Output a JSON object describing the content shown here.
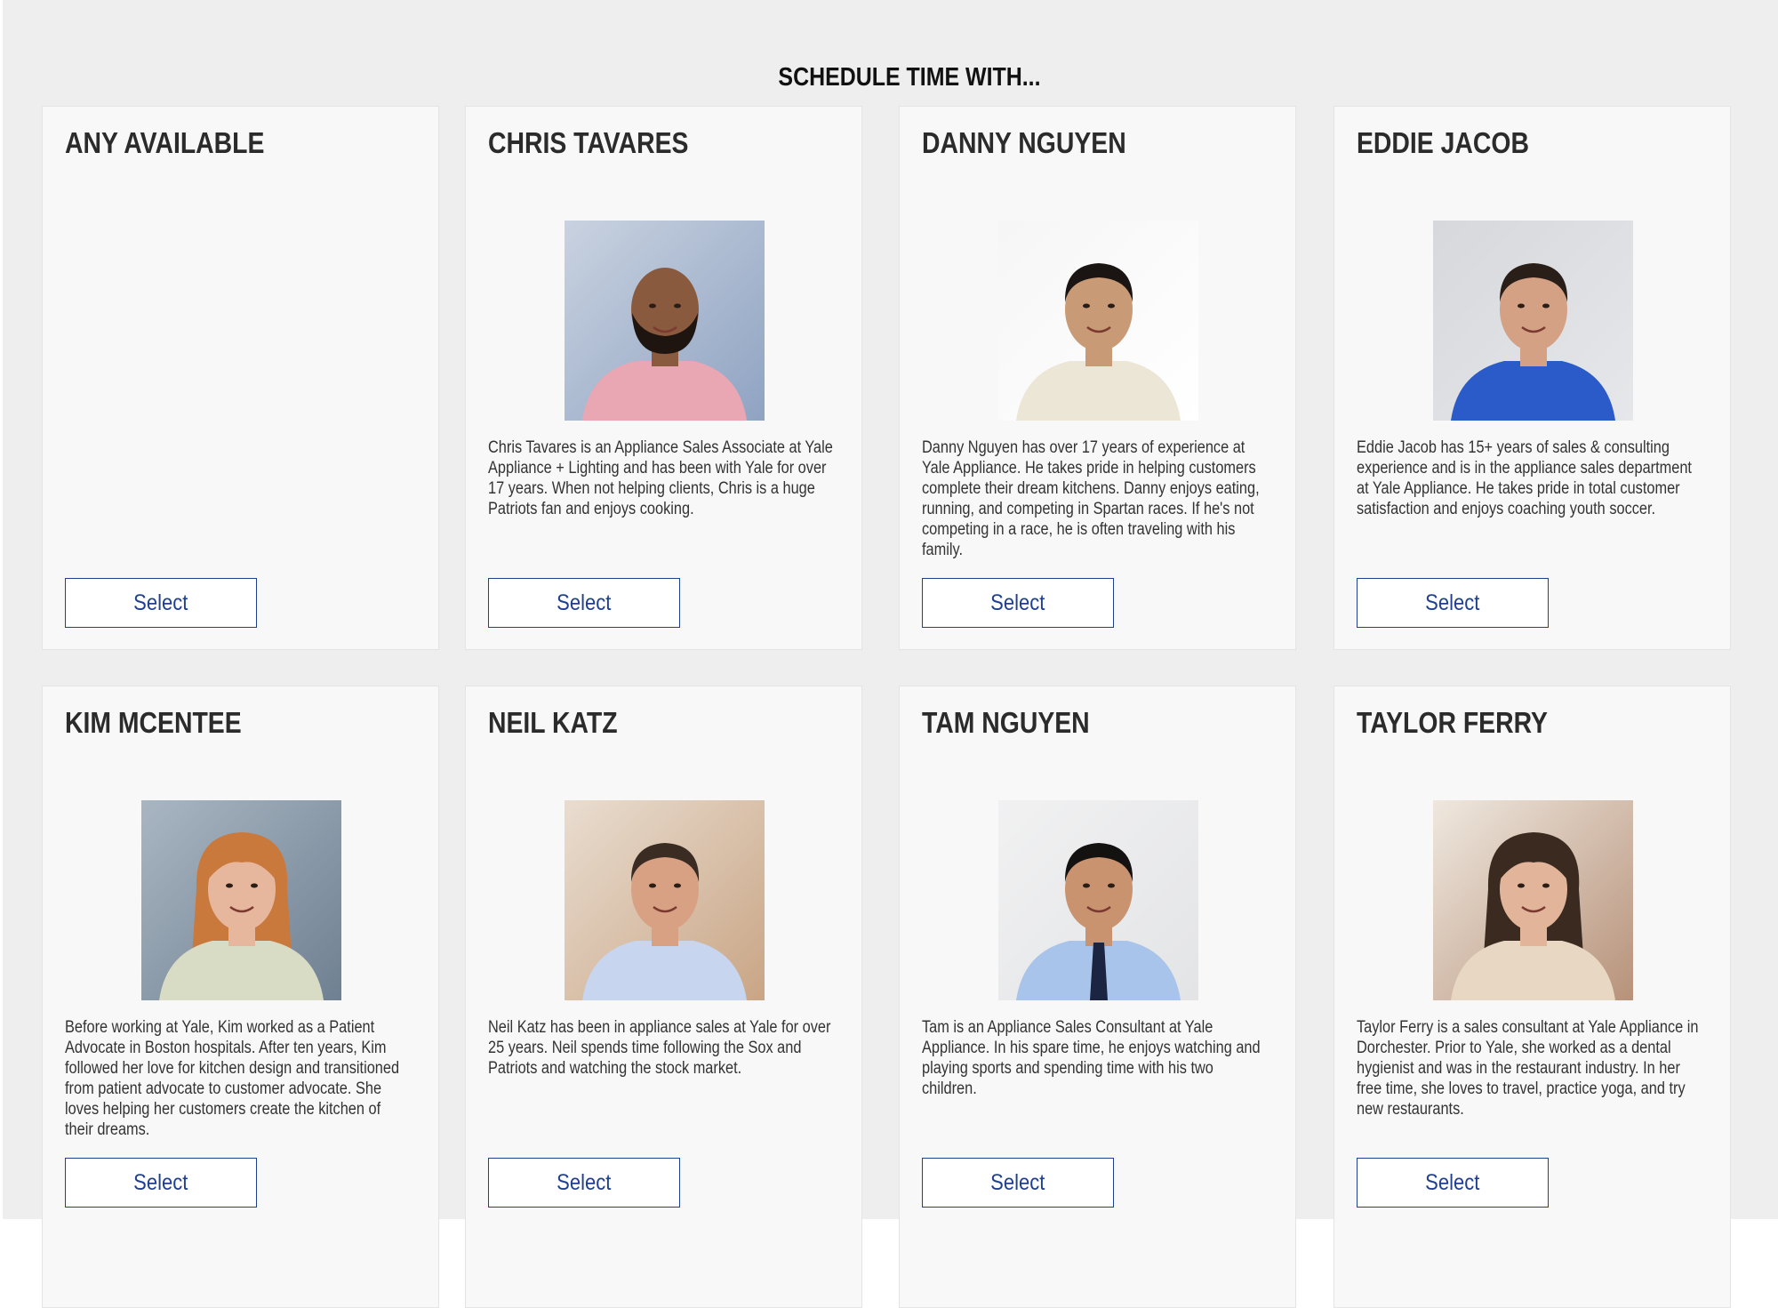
{
  "header": {
    "title": "SCHEDULE TIME WITH..."
  },
  "cards": [
    {
      "name": "ANY AVAILABLE",
      "bio": "",
      "button": "Select",
      "photo": null
    },
    {
      "name": "CHRIS TAVARES",
      "bio": "Chris Tavares is an Appliance Sales Associate at Yale Appliance + Lighting and has been with Yale for over 17 years. When not helping clients, Chris is a huge Patriots fan and enjoys cooking.",
      "button": "Select",
      "photo": {
        "bg": "#8fa3c2",
        "bg2": "#c9d2e0",
        "skin": "#8a5a3e",
        "hair": "#1e1410",
        "shirt": "#e8a7b3",
        "beard": true,
        "bald": true
      }
    },
    {
      "name": "DANNY NGUYEN",
      "bio": "Danny Nguyen has over 17 years of experience at Yale Appliance. He takes pride in helping customers complete their dream kitchens. Danny enjoys eating, running, and competing in Spartan races. If he's not competing in a race, he is often traveling with his family.",
      "button": "Select",
      "photo": {
        "bg": "#ffffff",
        "bg2": "#f6f6f6",
        "skin": "#c89a75",
        "hair": "#1a1512",
        "shirt": "#ece6d6",
        "beard": false,
        "bald": false
      }
    },
    {
      "name": "EDDIE JACOB",
      "bio": "Eddie Jacob has 15+ years of sales & consulting experience and is in the appliance sales department at Yale Appliance. He takes pride in total customer satisfaction and enjoys coaching youth soccer.",
      "button": "Select",
      "photo": {
        "bg": "#e6e7ea",
        "bg2": "#d6d8dc",
        "skin": "#d4a184",
        "hair": "#2a1f18",
        "shirt": "#2a5bc9",
        "beard": false,
        "bald": false
      }
    },
    {
      "name": "KIM MCENTEE",
      "bio": "Before working at Yale, Kim worked as a Patient Advocate in Boston hospitals. After ten years, Kim followed her love for kitchen design and transitioned from patient advocate to customer advocate. She loves helping her customers create the kitchen of their dreams.",
      "button": "Select",
      "photo": {
        "bg": "#6f8092",
        "bg2": "#a9b6c2",
        "skin": "#e7b79d",
        "hair": "#c9793c",
        "shirt": "#d9dcc4",
        "beard": false,
        "bald": false,
        "longhair": true
      }
    },
    {
      "name": "NEIL KATZ",
      "bio": "Neil Katz has been in appliance sales at Yale for over 25 years. Neil spends time following the Sox and Patriots and watching the stock market.",
      "button": "Select",
      "photo": {
        "bg": "#c9a585",
        "bg2": "#e9ddd0",
        "skin": "#d8a183",
        "hair": "#3a2c22",
        "shirt": "#c7d5ee",
        "beard": false,
        "bald": false
      }
    },
    {
      "name": "TAM NGUYEN",
      "bio": "Tam is an Appliance Sales Consultant at Yale Appliance. In his spare time, he enjoys watching and playing sports and spending time with his two children.",
      "button": "Select",
      "photo": {
        "bg": "#e3e4e6",
        "bg2": "#f1f1f2",
        "skin": "#c9936f",
        "hair": "#141210",
        "shirt": "#a9c4ea",
        "beard": false,
        "bald": false,
        "tie": true
      }
    },
    {
      "name": "TAYLOR FERRY",
      "bio": "Taylor Ferry is a sales consultant at Yale Appliance in Dorchester. Prior to Yale, she worked as a dental hygienist and was in the restaurant industry. In her free time, she loves to travel, practice yoga, and try new restaurants.",
      "button": "Select",
      "photo": {
        "bg": "#b7927a",
        "bg2": "#efe8df",
        "skin": "#e2b49a",
        "hair": "#3a2a20",
        "shirt": "#e7d7c3",
        "beard": false,
        "bald": false,
        "longhair": true
      }
    }
  ]
}
